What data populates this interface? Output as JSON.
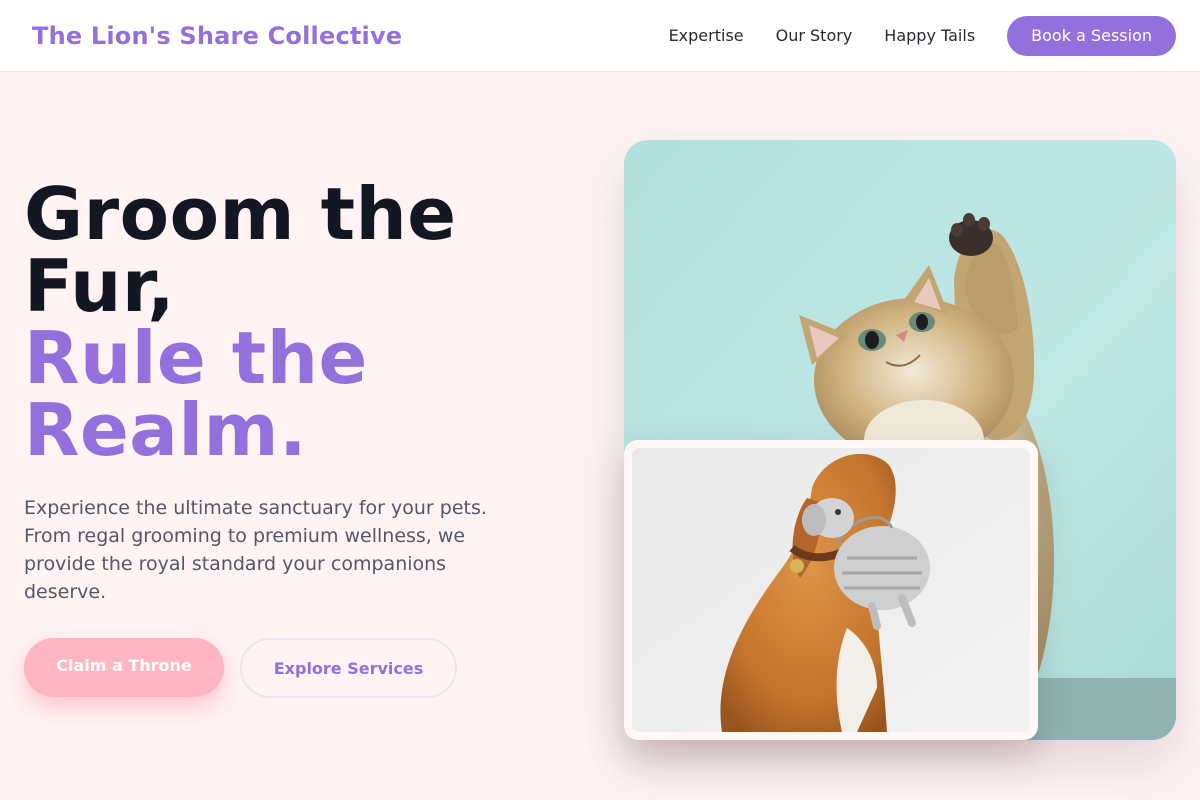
{
  "nav": {
    "brand": "The Lion's Share Collective",
    "links": [
      "Expertise",
      "Our Story",
      "Happy Tails"
    ],
    "cta": "Book a Session"
  },
  "hero": {
    "title_line1": "Groom the",
    "title_line2": "Fur,",
    "title_accent_line1": "Rule the",
    "title_accent_line2": "Realm.",
    "subtitle": "Experience the ultimate sanctuary for your pets. From regal grooming to premium wellness, we provide the royal standard your companions deserve.",
    "primary_cta": "Claim a Throne",
    "secondary_cta": "Explore Services"
  },
  "colors": {
    "brand": "#9370db",
    "primary_button": "#ffb6c1",
    "background": "#fff3f3",
    "heading": "#131722"
  },
  "images": {
    "main": "kitten-reaching-photo",
    "secondary": "dog-with-toy-photo"
  }
}
